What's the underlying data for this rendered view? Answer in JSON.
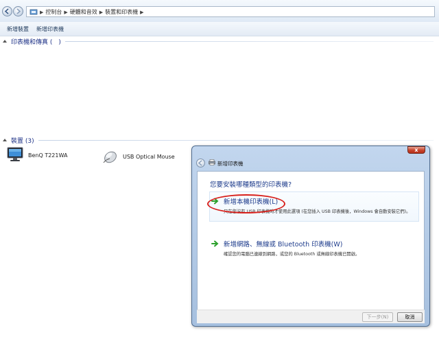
{
  "address_bar": {
    "breadcrumbs": [
      "控制台",
      "硬體和音效",
      "裝置和印表機"
    ]
  },
  "command_bar": {
    "add_device": "新增裝置",
    "add_printer": "新增印表機"
  },
  "groups": {
    "printers": {
      "title": "印表機和傳真 (　)"
    },
    "devices": {
      "title": "裝置 (3)"
    }
  },
  "devices": [
    {
      "name": "BenQ T221WA",
      "icon": "monitor-icon"
    },
    {
      "name": "USB Optical Mouse",
      "icon": "mouse-icon"
    }
  ],
  "dialog": {
    "title": "新增印表機",
    "close_label": "x",
    "heading": "您要安裝哪種類型的印表機?",
    "options": [
      {
        "title": "新增本機印表機(L)",
        "desc": "只在您沒有 USB 印表機時才使用此選項 (在您插入 USB 印表機後，Windows 會自動安裝它們)。"
      },
      {
        "title": "新增網路、無線或 Bluetooth 印表機(W)",
        "desc": "確認您的電腦已連線到網路，或您的 Bluetooth 或無線印表機已開啟。"
      }
    ],
    "next_button": "下一步(N)",
    "cancel_button": "取消"
  },
  "colors": {
    "accent_blue": "#1e3c8c",
    "arrow_green": "#2da02d",
    "annotation_red": "#d8201b"
  }
}
